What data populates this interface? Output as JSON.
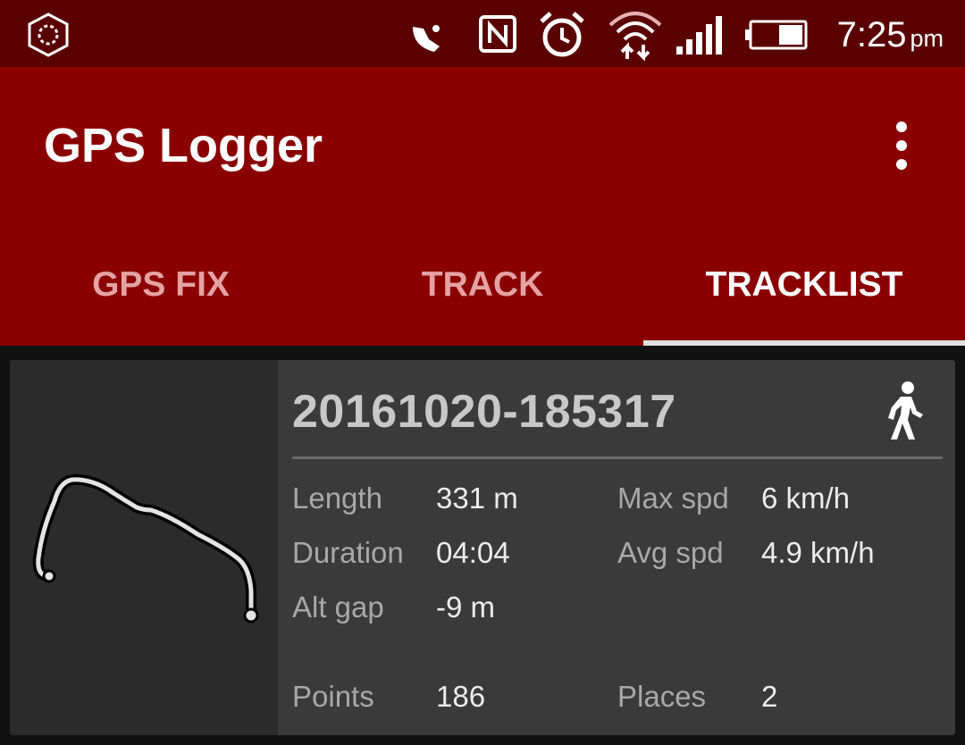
{
  "status_bar": {
    "time": "7:25",
    "ampm": "pm",
    "icons": [
      "app-notification-icon",
      "satellite-icon",
      "nfc-icon",
      "alarm-icon",
      "wifi-icon",
      "signal-icon",
      "battery-icon"
    ]
  },
  "app_bar": {
    "title": "GPS Logger",
    "menu_icon": "more-vert-icon"
  },
  "tabs": [
    {
      "label": "GPS FIX",
      "active": false
    },
    {
      "label": "TRACK",
      "active": false
    },
    {
      "label": "TRACKLIST",
      "active": true
    }
  ],
  "tracklist": {
    "items": [
      {
        "name": "20161020-185317",
        "activity_icon": "walking-icon",
        "stats": {
          "length_label": "Length",
          "length_value": "331 m",
          "duration_label": "Duration",
          "duration_value": "04:04",
          "altgap_label": "Alt gap",
          "altgap_value": "-9 m",
          "maxspd_label": "Max spd",
          "maxspd_value": "6 km/h",
          "avgspd_label": "Avg spd",
          "avgspd_value": "4.9 km/h",
          "points_label": "Points",
          "points_value": "186",
          "places_label": "Places",
          "places_value": "2"
        }
      }
    ]
  },
  "colors": {
    "status_bar": "#5a0000",
    "app_bar": "#8a0000",
    "tab_inactive": "#e6a2a2",
    "tab_indicator": "#e0e0e0",
    "card": "#3a3a3a"
  }
}
